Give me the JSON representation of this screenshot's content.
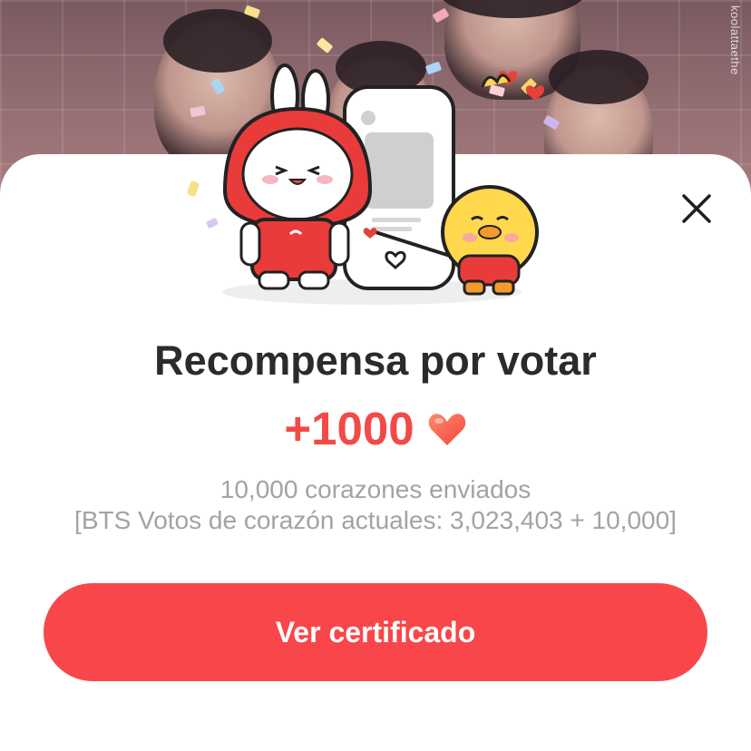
{
  "background": {
    "watermark": "koolattaethe"
  },
  "modal": {
    "title": "Recompensa por votar",
    "reward_amount": "+1000",
    "reward_icon": "heart-icon",
    "hearts_sent": "10,000 corazones enviados",
    "votes_summary": "[BTS Votos de corazón actuales: 3,023,403 + 10,000]",
    "cta_label": "Ver certificado",
    "close_icon": "close-icon"
  },
  "colors": {
    "accent": "#f8464a",
    "reward_text": "#f24a47",
    "title_text": "#2b2b2b",
    "secondary_text": "#a3a3a3"
  }
}
